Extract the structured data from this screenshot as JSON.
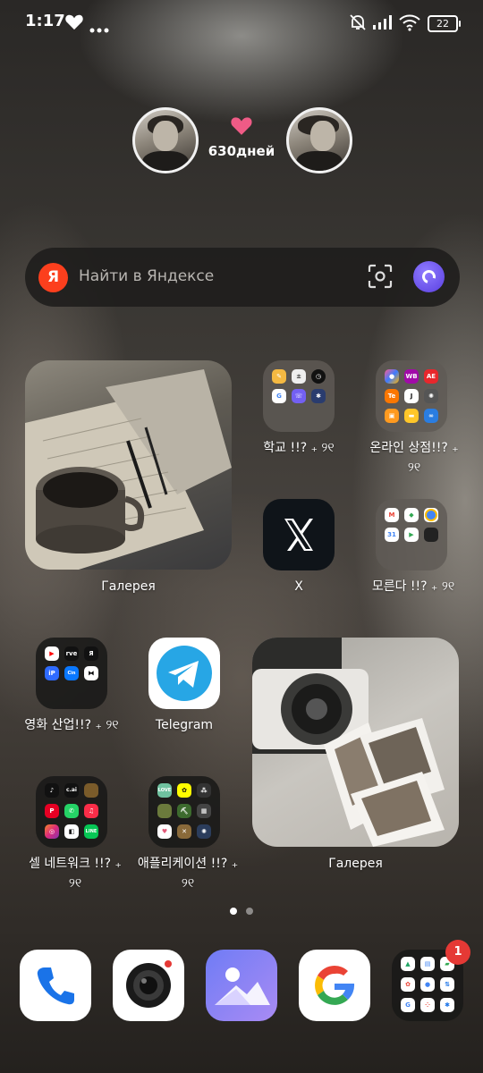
{
  "status_bar": {
    "time": "1:17",
    "icons": [
      "heart-icon",
      "more-dots-icon",
      "silent-bell-icon",
      "signal-icon",
      "wifi-icon",
      "battery-icon"
    ],
    "battery_level": "22"
  },
  "couple_widget": {
    "days_text": "630дней",
    "heart_color": "#ef5b86"
  },
  "search": {
    "logo": "Я",
    "placeholder": "Найти в Яндексе",
    "accent": "#fc3f1d"
  },
  "home": {
    "gallery_widget_1": {
      "label": "Галерея"
    },
    "folder_school": {
      "label": "학교 !!? ₊ ୨୧"
    },
    "folder_shopping": {
      "label": "온라인 상점!!? ₊",
      "label_extra": "୨୧"
    },
    "app_x": {
      "label": "X",
      "glyph": "X"
    },
    "folder_unknown": {
      "label": "모른다 !!? ₊ ୨୧"
    },
    "folder_film": {
      "label": "영화 산업!!? ₊ ୨୧"
    },
    "app_telegram": {
      "label": "Telegram"
    },
    "gallery_widget_2": {
      "label": "Галерея"
    },
    "folder_social": {
      "label": "셀 네트워크 !!? ₊",
      "label_extra": "୨୧"
    },
    "folder_apps": {
      "label": "애플리케이션 !!? ₊",
      "label_extra": "୨୧"
    }
  },
  "folder_minis": {
    "school": [
      "Pencil",
      "Calc",
      "Clock",
      "GT",
      "Viber",
      "Gear"
    ],
    "shopping": [
      "OZ",
      "WB",
      "AE",
      "Tmu",
      "J",
      "MB",
      "Bag",
      "Fld",
      "Inf"
    ],
    "unknown": [
      "M",
      "Maps",
      "Chr",
      "Cal",
      "Play",
      ""
    ],
    "film": [
      "YT",
      "rave",
      "Я",
      "iP",
      "Cinema",
      "CC"
    ],
    "social": [
      "TT",
      "c.ai",
      "",
      "Pin",
      "WA",
      "Music",
      "IG",
      "",
      "LINE"
    ],
    "apps": [
      "LOVE",
      "Snap",
      "Fig",
      "Pix",
      "Mine",
      "Puz",
      "Heart",
      "Craft",
      "Bugs"
    ]
  },
  "pages": {
    "count": 2,
    "current": 1
  },
  "dock": {
    "apps": [
      "phone-app",
      "camera-app",
      "gallery-app",
      "google-app",
      "google-folder"
    ],
    "badge": "1"
  }
}
